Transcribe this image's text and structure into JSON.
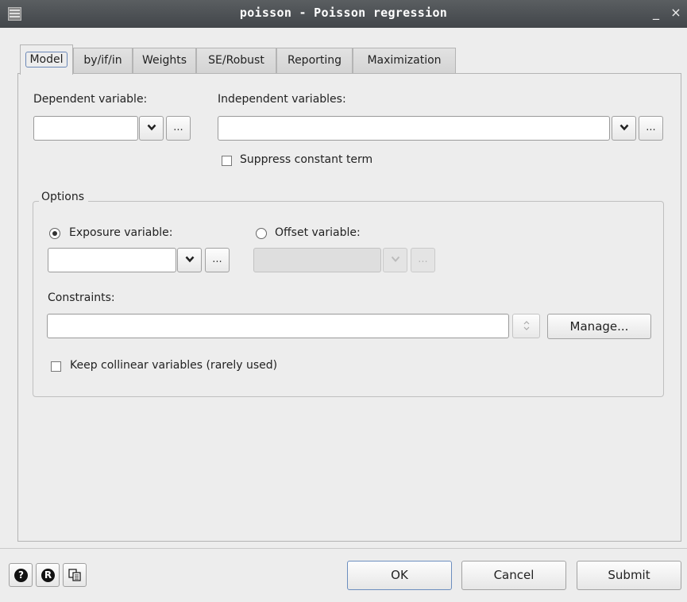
{
  "window": {
    "title": "poisson - Poisson regression",
    "minimize_glyph": "_",
    "close_glyph": "×",
    "app_icon": "dialog-icon"
  },
  "tabs": [
    {
      "label": "Model",
      "active": true
    },
    {
      "label": "by/if/in"
    },
    {
      "label": "Weights"
    },
    {
      "label": "SE/Robust"
    },
    {
      "label": "Reporting"
    },
    {
      "label": "Maximization"
    }
  ],
  "model": {
    "dependent_label": "Dependent variable:",
    "dependent_value": "",
    "independent_label": "Independent variables:",
    "independent_value": "",
    "suppress_constant_label": "Suppress constant term",
    "suppress_constant_checked": false,
    "browse_glyph": "...",
    "options": {
      "title": "Options",
      "exposure_label": "Exposure variable:",
      "exposure_selected": true,
      "exposure_value": "",
      "offset_label": "Offset variable:",
      "offset_selected": false,
      "offset_value": "",
      "constraints_label": "Constraints:",
      "constraints_value": "",
      "manage_label": "Manage...",
      "collinear_label": "Keep collinear variables (rarely used)",
      "collinear_checked": false
    }
  },
  "footer": {
    "help_glyph": "?",
    "reset_glyph": "R",
    "ok_label": "OK",
    "cancel_label": "Cancel",
    "submit_label": "Submit"
  },
  "colors": {
    "titlebar": "#4b4f52",
    "dialog_bg": "#ededed",
    "default_button_border": "#6c8ebf"
  }
}
